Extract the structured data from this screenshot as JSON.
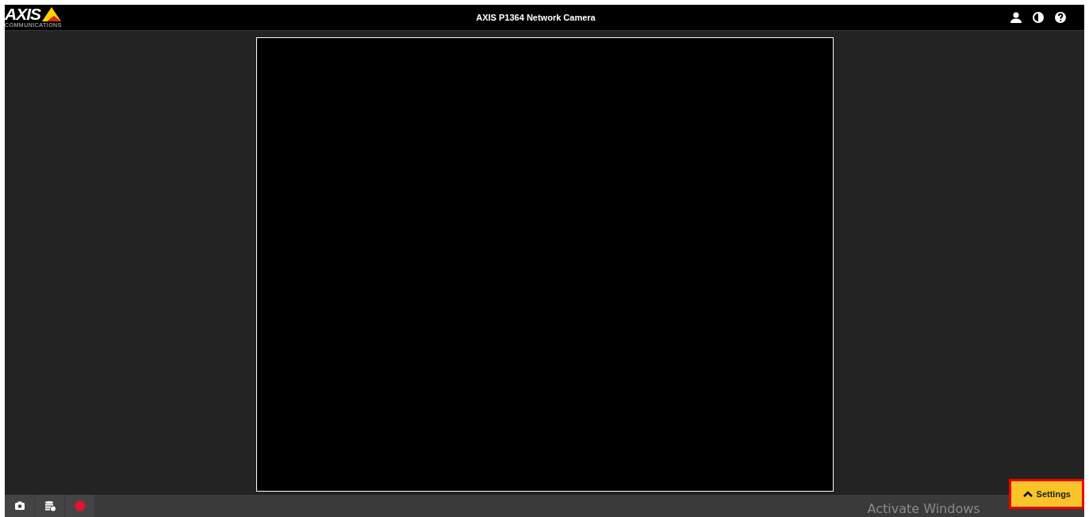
{
  "header": {
    "logo": {
      "name": "AXIS",
      "tagline": "COMMUNICATIONS"
    },
    "title": "AXIS P1364 Network Camera"
  },
  "toolbar": {
    "tools": [
      {
        "kind": "snapshot"
      },
      {
        "kind": "storage"
      },
      {
        "kind": "record"
      }
    ]
  },
  "os_notice": "Activate Windows",
  "settings_button": {
    "label": "Settings",
    "highlighted": true
  }
}
